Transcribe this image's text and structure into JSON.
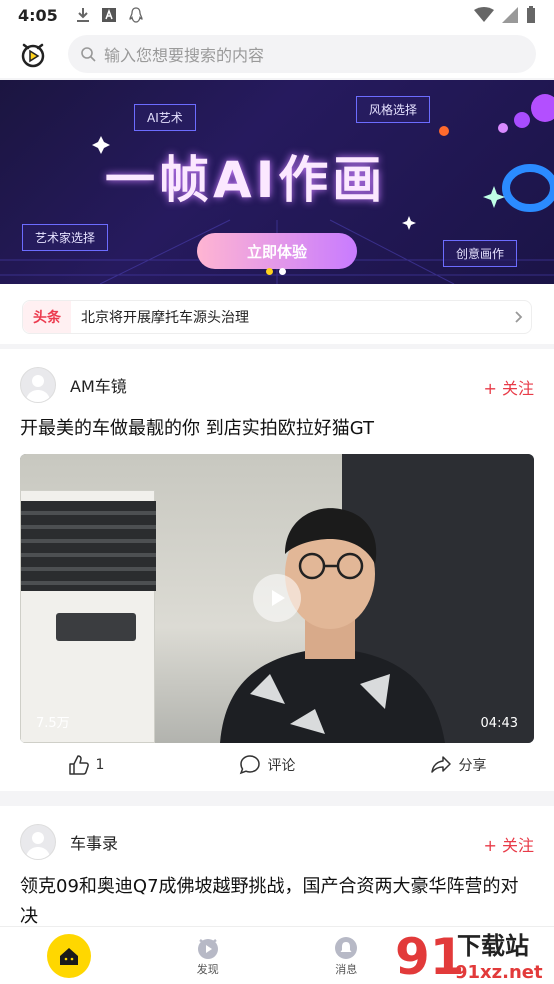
{
  "status": {
    "time": "4:05"
  },
  "header": {
    "search_placeholder": "输入您想要搜索的内容"
  },
  "banner": {
    "title": "一帧AI作画",
    "tags": [
      "AI艺术",
      "风格选择",
      "艺术家选择",
      "创意画作"
    ],
    "cta": "立即体验"
  },
  "headline": {
    "tag": "头条",
    "text": "北京将开展摩托车源头治理"
  },
  "posts": [
    {
      "author": "AM车镜",
      "follow": "+ 关注",
      "title": "开最美的车做最靓的你 到店实拍欧拉好猫GT",
      "views": "7.5万",
      "duration": "04:43",
      "likes": "1",
      "comment_label": "评论",
      "share_label": "分享"
    },
    {
      "author": "车事录",
      "follow": "+ 关注",
      "title": "领克09和奥迪Q7成佛坡越野挑战，国产合资两大豪华阵营的对决"
    }
  ],
  "tabbar": {
    "discover": "发现",
    "messages": "消息"
  },
  "watermark": {
    "text1": "下载站",
    "text2": "91xz.net",
    "num": "91"
  },
  "colors": {
    "accent": "#ffd700",
    "follow": "#e83b48",
    "headline_tag": "#ec3b4f"
  }
}
